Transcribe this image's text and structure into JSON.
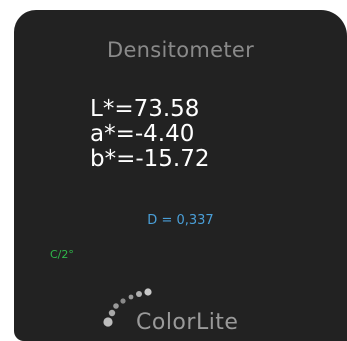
{
  "app": {
    "title": "Densitometer"
  },
  "readings": {
    "l": "L*=73.58",
    "a": "a*=-4.40",
    "b": "b*=-15.72",
    "density": "D = 0,337",
    "illuminant": "C/2°"
  },
  "brand": {
    "name": "ColorLite",
    "icon": "colorlite-dots-logo-icon"
  },
  "colors": {
    "panel_bg": "#222222",
    "title": "#8a8a8a",
    "values": "#ffffff",
    "density": "#4a9fd8",
    "illuminant": "#2fb84a",
    "logo": "#9a9a9a"
  }
}
